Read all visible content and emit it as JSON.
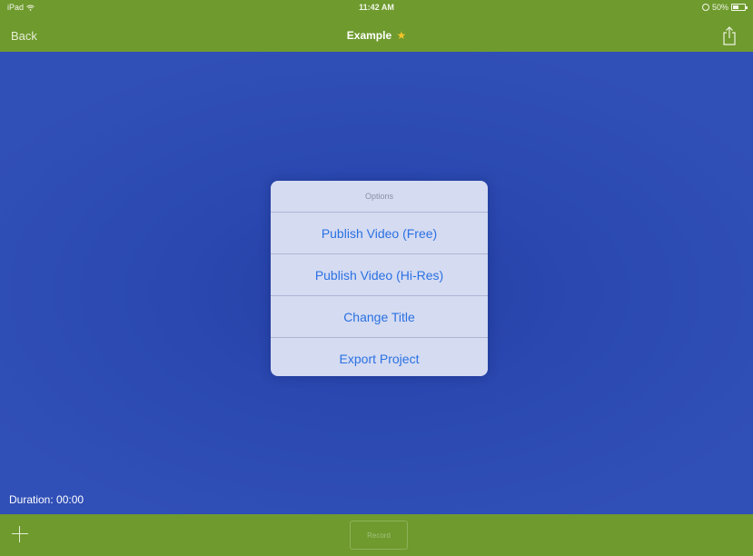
{
  "status_bar": {
    "device": "iPad",
    "time": "11:42 AM",
    "battery": "50%"
  },
  "nav": {
    "back_label": "Back",
    "title": "Example",
    "star_glyph": "★",
    "share_icon": "share-icon"
  },
  "canvas": {
    "duration_label": "Duration: 00:00"
  },
  "options": {
    "header": "Options",
    "items": [
      "Publish Video (Free)",
      "Publish Video (Hi-Res)",
      "Change Title",
      "Export Project"
    ]
  },
  "toolbar": {
    "add_icon": "plus-icon",
    "record_label": "Record"
  },
  "colors": {
    "accent_green": "#6e9a2e",
    "canvas_blue": "#2f4fb6",
    "popup_bg": "#d5dbf1",
    "link_blue": "#2a71e3",
    "star_yellow": "#f6c529"
  }
}
